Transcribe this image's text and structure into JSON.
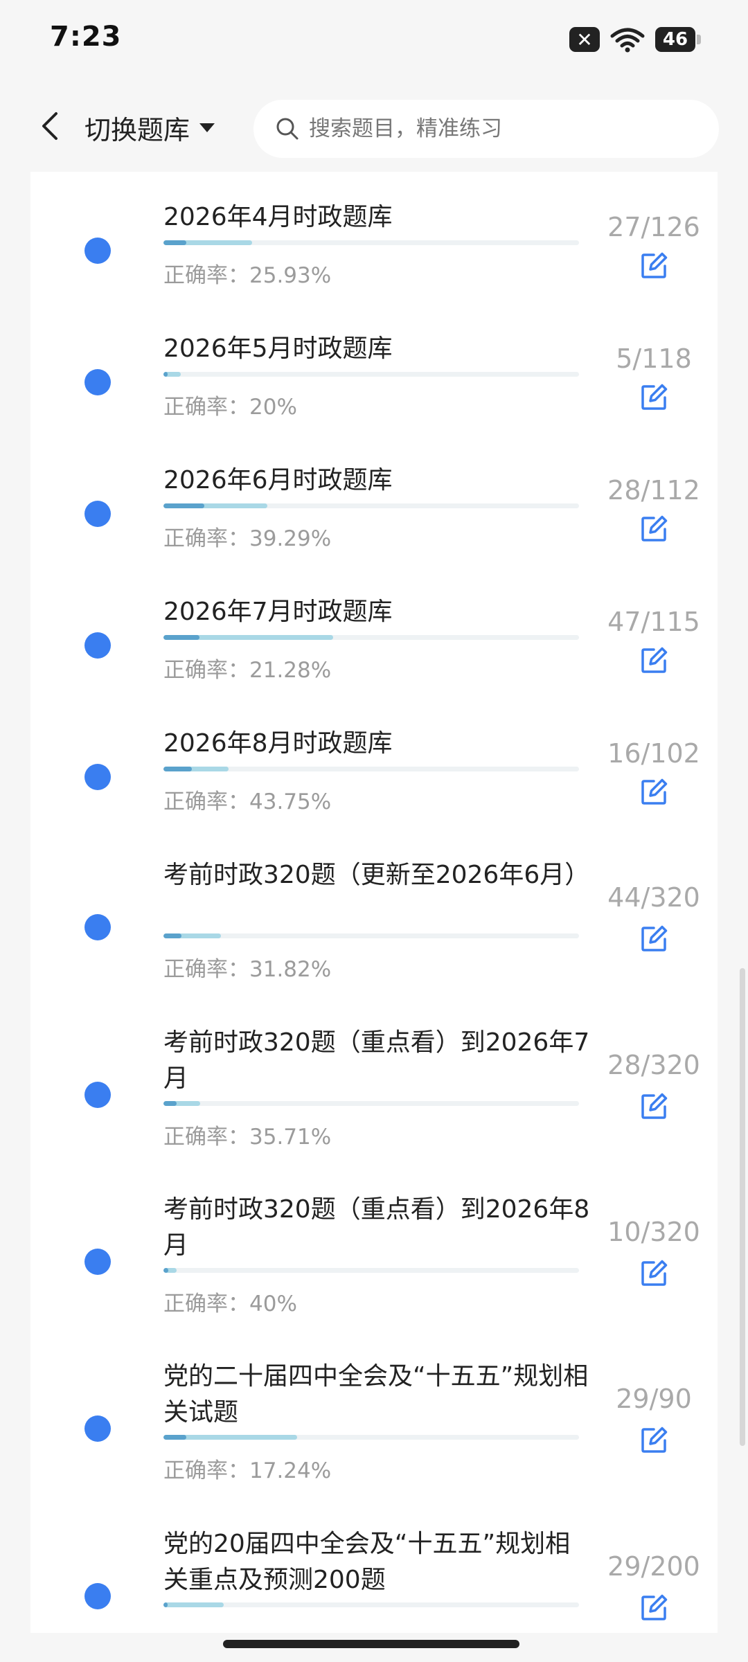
{
  "status": {
    "time": "7:23",
    "battery": "46"
  },
  "header": {
    "switch_label": "切换题库",
    "search_placeholder": "搜索题目，精准练习"
  },
  "items": [
    {
      "title": "2026年4月时政题库",
      "accuracy": "正确率：25.93%",
      "count": "27/126",
      "progress": 0.214,
      "accuracy_value": 0.2593
    },
    {
      "title": "2026年5月时政题库",
      "accuracy": "正确率：20%",
      "count": "5/118",
      "progress": 0.042,
      "accuracy_value": 0.2
    },
    {
      "title": "2026年6月时政题库",
      "accuracy": "正确率：39.29%",
      "count": "28/112",
      "progress": 0.25,
      "accuracy_value": 0.3929
    },
    {
      "title": "2026年7月时政题库",
      "accuracy": "正确率：21.28%",
      "count": "47/115",
      "progress": 0.409,
      "accuracy_value": 0.2128
    },
    {
      "title": "2026年8月时政题库",
      "accuracy": "正确率：43.75%",
      "count": "16/102",
      "progress": 0.157,
      "accuracy_value": 0.4375
    },
    {
      "title": "考前时政320题（更新至2026年6月）",
      "accuracy": "正确率：31.82%",
      "count": "44/320",
      "progress": 0.1375,
      "accuracy_value": 0.3182
    },
    {
      "title": "考前时政320题（重点看）到2026年7月",
      "accuracy": "正确率：35.71%",
      "count": "28/320",
      "progress": 0.0875,
      "accuracy_value": 0.3571
    },
    {
      "title": "考前时政320题（重点看）到2026年8月",
      "accuracy": "正确率：40%",
      "count": "10/320",
      "progress": 0.031,
      "accuracy_value": 0.4
    },
    {
      "title": "党的二十届四中全会及“十五五”规划相关试题",
      "accuracy": "正确率：17.24%",
      "count": "29/90",
      "progress": 0.322,
      "accuracy_value": 0.1724
    },
    {
      "title": "党的20届四中全会及“十五五”规划相关重点及预测200题",
      "accuracy": "",
      "count": "29/200",
      "progress": 0.145,
      "accuracy_value": 0.0
    }
  ]
}
